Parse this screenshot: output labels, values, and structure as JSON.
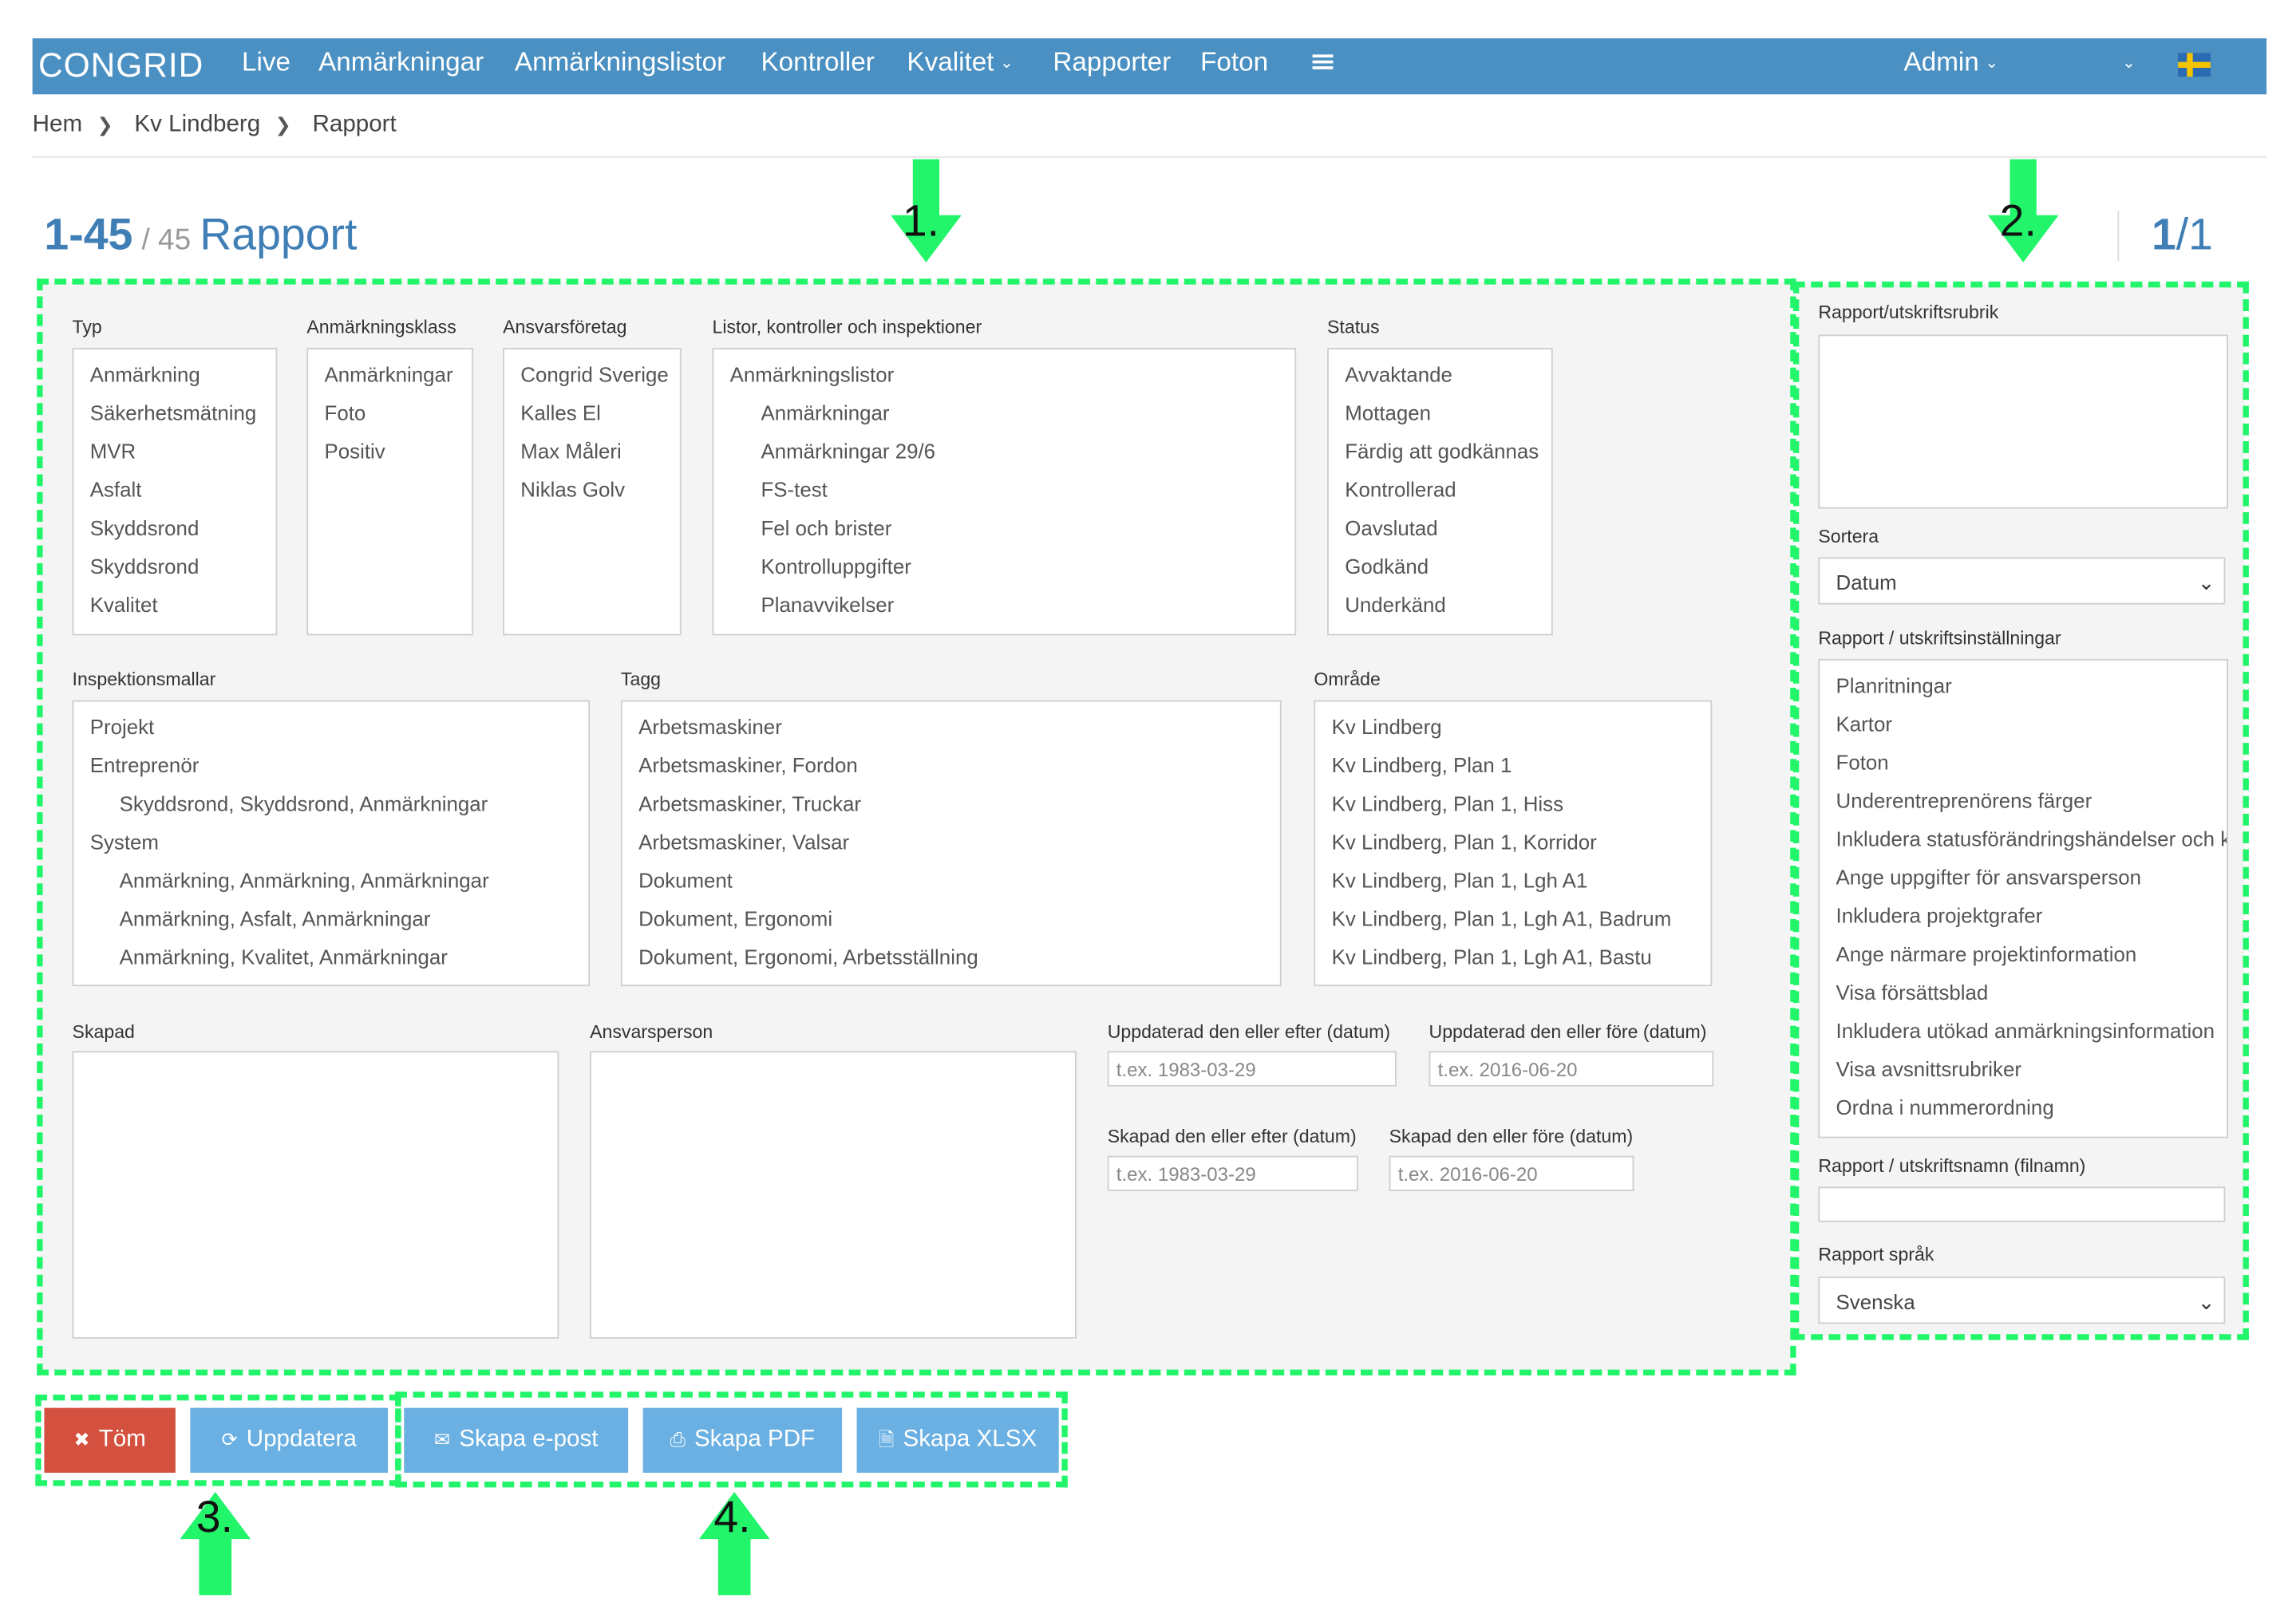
{
  "nav": {
    "brand": "CONGRID",
    "items": [
      "Live",
      "Anmärkningar",
      "Anmärkningslistor",
      "Kontroller",
      "Kvalitet",
      "Rapporter",
      "Foton"
    ],
    "user": "Admin",
    "flag_colors": {
      "blue": "#2a6bb3",
      "yellow": "#f5c400"
    },
    "bar_color": "#4a90c2"
  },
  "breadcrumb": [
    "Hem",
    "Kv Lindberg",
    "Rapport"
  ],
  "title": {
    "range": "1-45",
    "total": "/ 45",
    "name": "Rapport",
    "pager_current": "1",
    "pager_total": "/1"
  },
  "filters": {
    "typ": {
      "label": "Typ",
      "options": [
        "Anmärkning",
        "Säkerhetsmätning",
        "MVR",
        "Asfalt",
        "Skyddsrond",
        "Skyddsrond",
        "Kvalitet"
      ]
    },
    "klass": {
      "label": "Anmärkningsklass",
      "options": [
        "Anmärkningar",
        "Foto",
        "Positiv"
      ]
    },
    "foretag": {
      "label": "Ansvarsföretag",
      "options": [
        "Congrid Sverige",
        "Kalles El",
        "Max Måleri",
        "Niklas Golv"
      ]
    },
    "listor": {
      "label": "Listor, kontroller och inspektioner",
      "options": [
        "Anmärkningslistor",
        "Anmärkningar",
        "Anmärkningar 29/6",
        "FS-test",
        "Fel och brister",
        "Kontrolluppgifter",
        "Planavvikelser"
      ]
    },
    "status": {
      "label": "Status",
      "options": [
        "Avvaktande",
        "Mottagen",
        "Färdig att godkännas",
        "Kontrollerad",
        "Oavslutad",
        "Godkänd",
        "Underkänd"
      ]
    },
    "mallar": {
      "label": "Inspektionsmallar",
      "options": [
        "Projekt",
        "Entreprenör",
        "Skyddsrond, Skyddsrond, Anmärkningar",
        "System",
        "Anmärkning, Anmärkning, Anmärkningar",
        "Anmärkning, Asfalt, Anmärkningar",
        "Anmärkning, Kvalitet, Anmärkningar"
      ]
    },
    "tagg": {
      "label": "Tagg",
      "options": [
        "Arbetsmaskiner",
        "Arbetsmaskiner, Fordon",
        "Arbetsmaskiner, Truckar",
        "Arbetsmaskiner, Valsar",
        "Dokument",
        "Dokument, Ergonomi",
        "Dokument, Ergonomi, Arbetsställning"
      ]
    },
    "omrade": {
      "label": "Område",
      "options": [
        "Kv Lindberg",
        "Kv Lindberg, Plan 1",
        "Kv Lindberg, Plan 1, Hiss",
        "Kv Lindberg, Plan 1, Korridor",
        "Kv Lindberg, Plan 1, Lgh A1",
        "Kv Lindberg, Plan 1, Lgh A1, Badrum",
        "Kv Lindberg, Plan 1, Lgh A1, Bastu"
      ]
    },
    "skapad": {
      "label": "Skapad"
    },
    "ansvarsperson": {
      "label": "Ansvarsperson"
    },
    "upd_efter": {
      "label": "Uppdaterad den eller efter (datum)",
      "placeholder": "t.ex. 1983-03-29"
    },
    "upd_fore": {
      "label": "Uppdaterad den eller före (datum)",
      "placeholder": "t.ex. 2016-06-20"
    },
    "sk_efter": {
      "label": "Skapad den eller efter (datum)",
      "placeholder": "t.ex. 1983-03-29"
    },
    "sk_fore": {
      "label": "Skapad den eller före (datum)",
      "placeholder": "t.ex. 2016-06-20"
    }
  },
  "side": {
    "rubrik_label": "Rapport/utskriftsrubrik",
    "sortera_label": "Sortera",
    "sortera_value": "Datum",
    "installningar_label": "Rapport / utskriftsinställningar",
    "installningar": [
      "Planritningar",
      "Kartor",
      "Foton",
      "Underentreprenörens färger",
      "Inkludera statusförändringshändelser och k",
      "Ange uppgifter för ansvarsperson",
      "Inkludera projektgrafer",
      "Ange närmare projektinformation",
      "Visa försättsblad",
      "Inkludera utökad anmärkningsinformation",
      "Visa avsnittsrubriker",
      "Ordna i nummerordning"
    ],
    "filnamn_label": "Rapport / utskriftsnamn (filnamn)",
    "sprak_label": "Rapport språk",
    "sprak_value": "Svenska"
  },
  "buttons": {
    "tom": "Töm",
    "uppdatera": "Uppdatera",
    "epost": "Skapa e-post",
    "pdf": "Skapa PDF",
    "xlsx": "Skapa XLSX"
  },
  "annotations": {
    "n1": "1.",
    "n2": "2.",
    "n3": "3.",
    "n4": "4.",
    "color": "#23f56b"
  }
}
